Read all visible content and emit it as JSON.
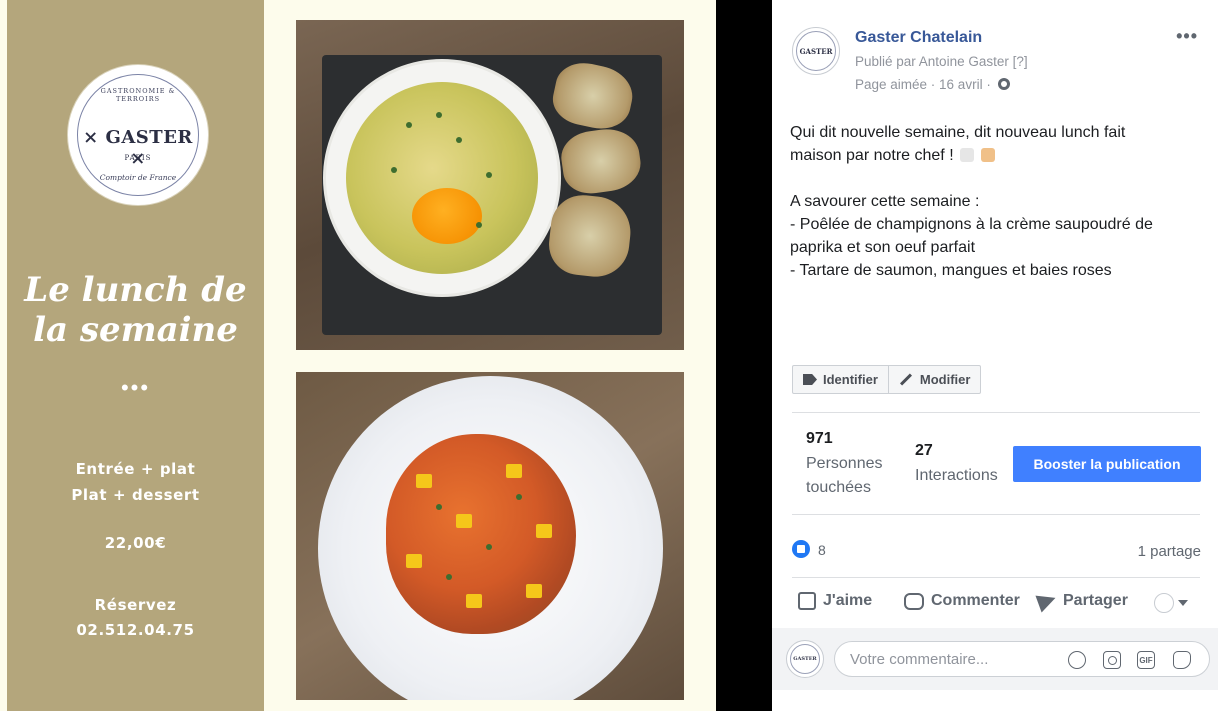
{
  "flyer": {
    "logo": {
      "arc_top": "GASTRONOMIE & TERROIRS",
      "name": "× GASTER ×",
      "city": "PARIS",
      "arc_bottom": "Comptoir de France"
    },
    "title": "Le lunch de la semaine",
    "dots": "•••",
    "formulas": [
      "Entrée + plat",
      "Plat + dessert"
    ],
    "price": "22,00€",
    "reserve_label": "Réservez",
    "phone": "02.512.04.75"
  },
  "post": {
    "page_name": "Gaster Chatelain",
    "published_by": "Publié par Antoine Gaster [?]",
    "meta": "Page aimée · 16 avril ·",
    "more": "•••",
    "avatar_text": "GASTER",
    "message": {
      "line1": "Qui dit nouvelle semaine, dit nouveau lunch fait",
      "line2": "maison par notre chef !",
      "line3": "A savourer cette semaine :",
      "line4": "- Poêlée de champignons à la crème saupoudré de",
      "line5": "paprika et son oeuf parfait",
      "line6": "- Tartare de saumon, mangues et baies roses"
    },
    "buttons": {
      "identify": "Identifier",
      "edit": "Modifier"
    },
    "stats": {
      "reach_value": "971",
      "reach_label_1": "Personnes",
      "reach_label_2": "touchées",
      "interactions_value": "27",
      "interactions_label": "Interactions",
      "boost_label": "Booster la publication"
    },
    "reactions": {
      "likes": "8",
      "shares": "1 partage"
    },
    "actions": {
      "like": "J'aime",
      "comment": "Commenter",
      "share": "Partager"
    },
    "comment_box": {
      "placeholder": "Votre commentaire...",
      "gif": "GIF"
    }
  },
  "colors": {
    "flyer_panel": "#b4a67c",
    "flyer_bg": "#fdfcec",
    "fb_link": "#385898",
    "boost_blue": "#4080ff",
    "like_blue": "#2078f4"
  }
}
